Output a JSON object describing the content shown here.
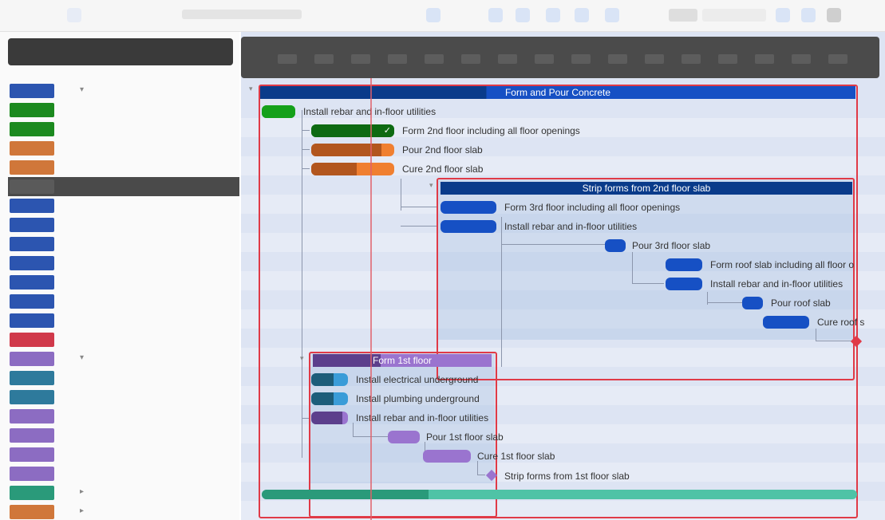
{
  "colors": {
    "blue_group": "#0a3b8a",
    "blue_task": "#1650c4",
    "green_dark": "#0e6a12",
    "green": "#14a01a",
    "orange_dark": "#b2561e",
    "orange": "#f07f30",
    "teal_dark": "#1d5d7a",
    "teal": "#3a9cd8",
    "purple_dark": "#5c3f8c",
    "purple": "#9a74cf",
    "red": "#e03a47",
    "selection": "#4a4a4a"
  },
  "outline": {
    "rows": [
      {
        "swatch": "#2c55b0",
        "indent": 0,
        "disclosure": "▾"
      },
      {
        "swatch": "#1c8a1f",
        "indent": 1
      },
      {
        "swatch": "#1c8a1f",
        "indent": 1
      },
      {
        "swatch": "#d0773a",
        "indent": 1
      },
      {
        "swatch": "#d0773a",
        "indent": 1
      },
      {
        "swatch": "#5a5a5a",
        "indent": 1,
        "selected": true
      },
      {
        "swatch": "#2c55b0",
        "indent": 2
      },
      {
        "swatch": "#2c55b0",
        "indent": 2
      },
      {
        "swatch": "#2c55b0",
        "indent": 2
      },
      {
        "swatch": "#2c55b0",
        "indent": 2
      },
      {
        "swatch": "#2c55b0",
        "indent": 2
      },
      {
        "swatch": "#2c55b0",
        "indent": 2
      },
      {
        "swatch": "#2c55b0",
        "indent": 2
      },
      {
        "swatch": "#d0394a",
        "indent": 2
      },
      {
        "swatch": "#8c6cc2",
        "indent": 0,
        "disclosure": "▾"
      },
      {
        "swatch": "#2e7a9c",
        "indent": 2
      },
      {
        "swatch": "#2e7a9c",
        "indent": 2
      },
      {
        "swatch": "#8c6cc2",
        "indent": 2
      },
      {
        "swatch": "#8c6cc2",
        "indent": 2
      },
      {
        "swatch": "#8c6cc2",
        "indent": 2
      },
      {
        "swatch": "#8c6cc2",
        "indent": 2
      },
      {
        "swatch": "#2a9a7a",
        "indent": 0,
        "disclosure": "▸"
      },
      {
        "swatch": "#d0773a",
        "indent": 0,
        "disclosure": "▸"
      }
    ]
  },
  "gantt": {
    "groups": {
      "main": {
        "title": "Form and Pour Concrete"
      },
      "sub2": {
        "title": "Strip forms from 2nd floor slab"
      },
      "sub1": {
        "title": "Form 1st floor"
      }
    },
    "tasks": [
      {
        "key": "t1",
        "label": "Install rebar and in-floor utilities",
        "progress": 1.0,
        "done": true,
        "color": "green",
        "color_dark": "green"
      },
      {
        "key": "t2",
        "label": "Form 2nd floor including all floor openings",
        "progress": 1.0,
        "done": true,
        "color": "green",
        "color_dark": "green_dark"
      },
      {
        "key": "t3",
        "label": "Pour 2nd floor slab",
        "progress": 0.85,
        "color": "orange",
        "color_dark": "orange_dark"
      },
      {
        "key": "t4",
        "label": "Cure 2nd floor slab",
        "progress": 0.55,
        "color": "orange",
        "color_dark": "orange_dark"
      },
      {
        "key": "t5",
        "label": "Form 3rd floor including all floor openings",
        "progress": 0,
        "color": "blue_task",
        "color_dark": "blue_task"
      },
      {
        "key": "t6",
        "label": "Install rebar and in-floor utilities",
        "progress": 0,
        "color": "blue_task",
        "color_dark": "blue_task"
      },
      {
        "key": "t7",
        "label": "Pour 3rd floor slab",
        "progress": 0,
        "color": "blue_task",
        "color_dark": "blue_task"
      },
      {
        "key": "t8",
        "label": "Form roof slab including all floor o",
        "progress": 0,
        "color": "blue_task",
        "color_dark": "blue_task"
      },
      {
        "key": "t9",
        "label": "Install rebar and in-floor utilities",
        "progress": 0,
        "color": "blue_task",
        "color_dark": "blue_task"
      },
      {
        "key": "t10",
        "label": "Pour roof slab",
        "progress": 0,
        "color": "blue_task",
        "color_dark": "blue_task"
      },
      {
        "key": "t11",
        "label": "Cure roof s",
        "progress": 0,
        "color": "blue_task",
        "color_dark": "blue_task"
      },
      {
        "key": "t12",
        "label": "Install electrical underground",
        "progress": 0.6,
        "color": "teal",
        "color_dark": "teal_dark"
      },
      {
        "key": "t13",
        "label": "Install plumbing underground",
        "progress": 0.6,
        "color": "teal",
        "color_dark": "teal_dark"
      },
      {
        "key": "t14",
        "label": "Install rebar and in-floor utilities",
        "progress": 0.85,
        "color": "purple",
        "color_dark": "purple_dark"
      },
      {
        "key": "t15",
        "label": "Pour 1st floor slab",
        "progress": 0,
        "color": "purple",
        "color_dark": "purple"
      },
      {
        "key": "t16",
        "label": "Cure 1st floor slab",
        "progress": 0,
        "color": "purple",
        "color_dark": "purple"
      }
    ],
    "milestones": {
      "m1": {
        "label": "Strip forms from 1st floor slab",
        "color": "purple"
      },
      "m2": {
        "label": "",
        "color": "red"
      }
    }
  }
}
